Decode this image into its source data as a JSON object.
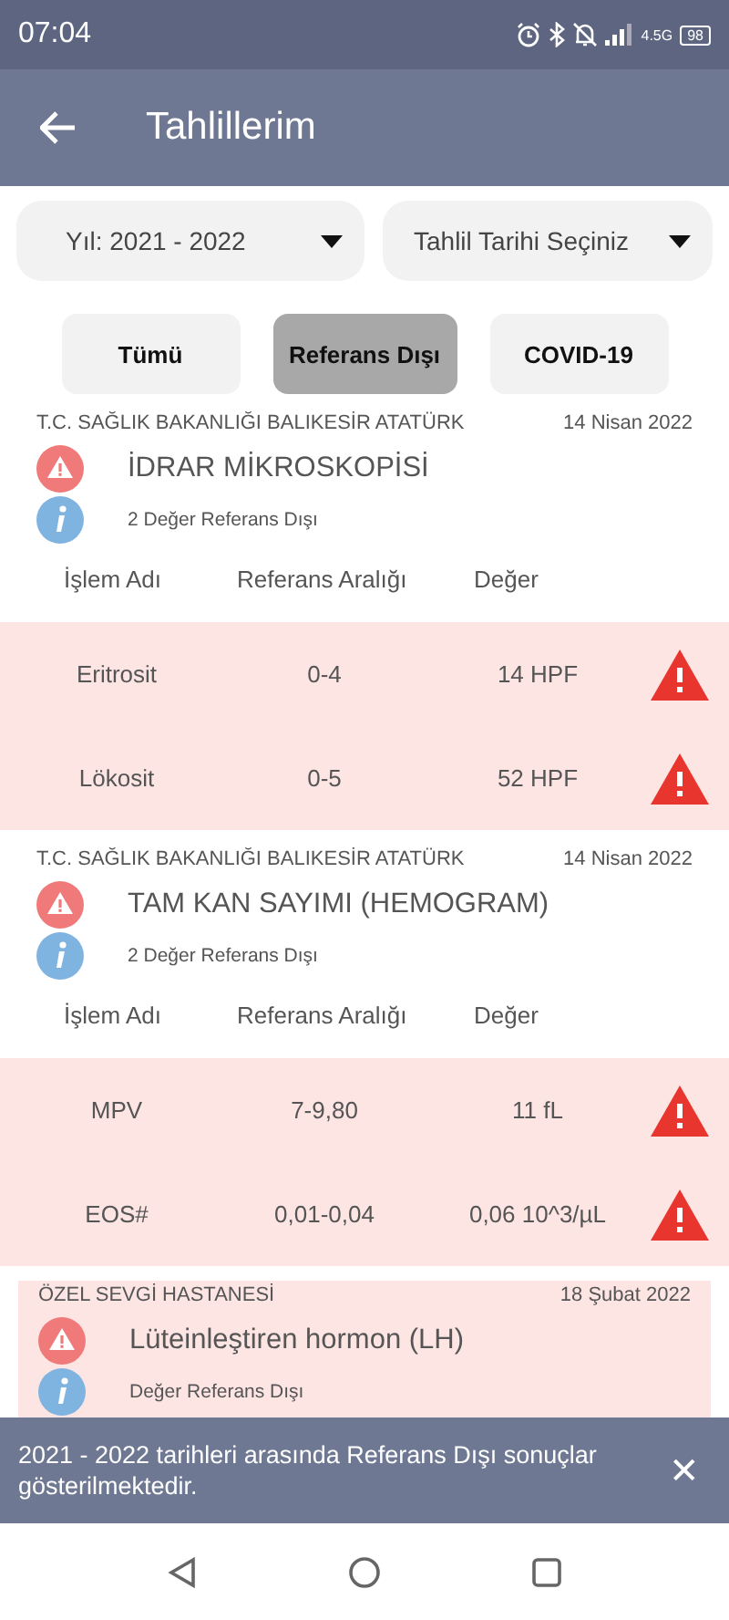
{
  "status_bar": {
    "time": "07:04",
    "network": "4.5G",
    "battery": "98"
  },
  "app_bar": {
    "title": "Tahlillerim"
  },
  "dropdowns": [
    {
      "value": "Yıl: 2021 - 2022"
    },
    {
      "value": "Tahlil Tarihi Seçiniz"
    }
  ],
  "filters": [
    {
      "label": "Tümü",
      "selected": false
    },
    {
      "label": "Referans Dışı",
      "selected": true
    },
    {
      "label": "COVID-19",
      "selected": false
    }
  ],
  "results": [
    {
      "hospital": "T.C. SAĞLIK BAKANLIĞI BALIKESİR ATATÜRK",
      "date": "14 Nisan 2022",
      "title": "İDRAR MİKROSKOPİSİ",
      "summary": "2 Değer Referans Dışı",
      "highlighted": false,
      "columns": [
        "İşlem Adı",
        "Referans Aralığı",
        "Değer"
      ],
      "rows": [
        {
          "name": "Eritrosit",
          "range": "0-4",
          "value": "14 HPF",
          "out_of_range": true
        },
        {
          "name": "Lökosit",
          "range": "0-5",
          "value": "52 HPF",
          "out_of_range": true
        }
      ]
    },
    {
      "hospital": "T.C. SAĞLIK BAKANLIĞI BALIKESİR ATATÜRK",
      "date": "14 Nisan 2022",
      "title": "TAM KAN SAYIMI (HEMOGRAM)",
      "summary": "2 Değer Referans Dışı",
      "highlighted": false,
      "columns": [
        "İşlem Adı",
        "Referans Aralığı",
        "Değer"
      ],
      "rows": [
        {
          "name": "MPV",
          "range": "7-9,80",
          "value": "11 fL",
          "out_of_range": true
        },
        {
          "name": "EOS#",
          "range": "0,01-0,04",
          "value": "0,06 10^3/µL",
          "out_of_range": true
        }
      ]
    },
    {
      "hospital": "ÖZEL SEVGİ HASTANESİ",
      "date": "18 Şubat 2022",
      "title": "Lüteinleştiren hormon (LH)",
      "summary": "Değer Referans Dışı",
      "highlighted": true
    }
  ],
  "snackbar": {
    "message": "2021 - 2022 tarihleri arasında Referans Dışı sonuçlar gösterilmektedir.",
    "close": "✕"
  }
}
